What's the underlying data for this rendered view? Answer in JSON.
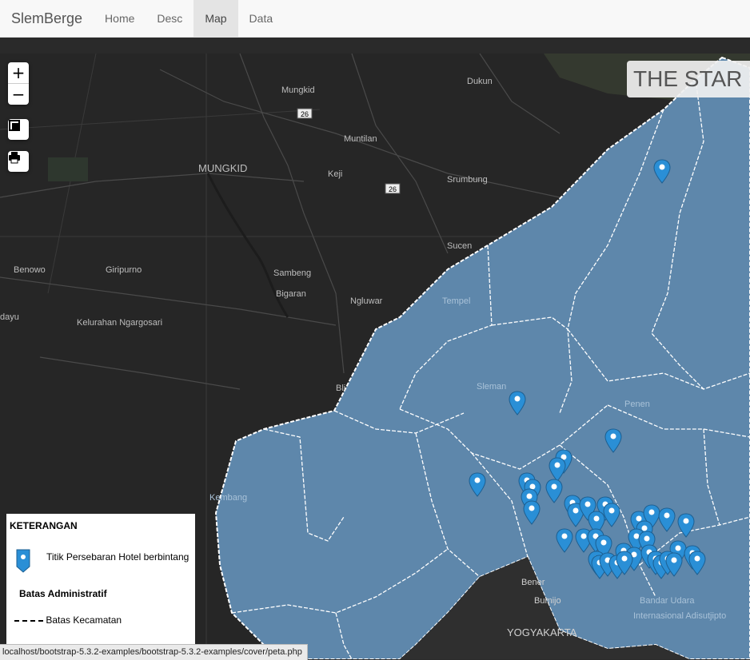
{
  "navbar": {
    "brand": "SlemBerge",
    "links": [
      {
        "label": "Home",
        "active": false
      },
      {
        "label": "Desc",
        "active": false
      },
      {
        "label": "Map",
        "active": true
      },
      {
        "label": "Data",
        "active": false
      }
    ]
  },
  "map": {
    "title": "THE STAR",
    "controls": {
      "zoom_in": "+",
      "zoom_out": "−",
      "icons": [
        "fullscreen-icon",
        "print-icon"
      ]
    },
    "basemap_labels": {
      "mungkid_small": "Mungkid",
      "dukun": "Dukun",
      "road1": "26",
      "road2": "26",
      "muntilan": "Muntilan",
      "mungkid_caps": "MUNGKID",
      "keji": "Keji",
      "srumbung": "Srumbung",
      "sucen": "Sucen",
      "benowo": "Benowo",
      "giripurno": "Giripurno",
      "sambeng": "Sambeng",
      "bigaran": "Bigaran",
      "ngluwar": "Ngluwar",
      "tempel": "Tempel",
      "dayu": "dayu",
      "ngargosari": "Kelurahan Ngargosari",
      "bli": "Bli",
      "sleman": "Sleman",
      "penen": "Penen",
      "kembang": "Kembang",
      "bener": "Bener",
      "bumijo": "Bumijo",
      "yogyakarta": "YOGYAKARTA",
      "bandara_1": "Bandar Udara",
      "bandara_2": "Internasional Adisutjipto"
    },
    "colors": {
      "region_fill": "#5e87ab",
      "boundary": "#ffffff",
      "marker": "#2a8fd6",
      "basemap": "#262626"
    }
  },
  "legend": {
    "heading": "KETERANGAN",
    "marker_label": "Titik Persebaran Hotel berbintang",
    "section": "Batas Administratif",
    "dash_label": "Batas Kecamatan"
  },
  "statusbar": {
    "url": "localhost/bootstrap-5.3.2-examples/bootstrap-5.3.2-examples/cover/peta.php"
  }
}
